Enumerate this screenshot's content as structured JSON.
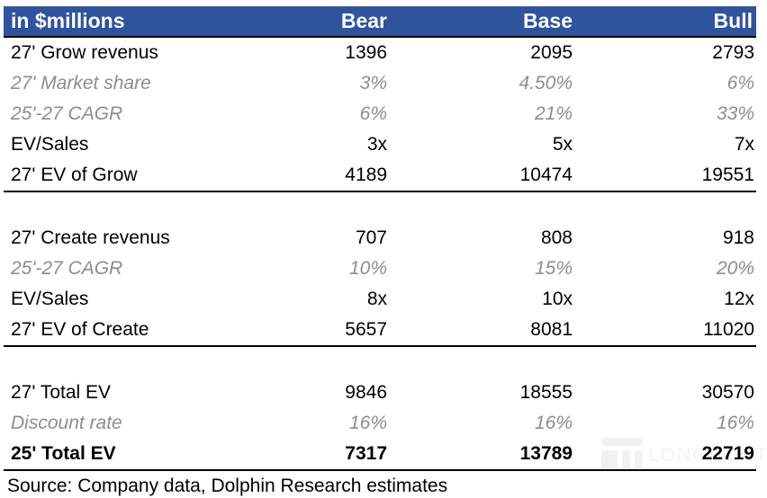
{
  "table": {
    "header": {
      "label": "in $millions",
      "columns": [
        "Bear",
        "Base",
        "Bull"
      ],
      "background_color": "#30539D",
      "text_color": "#FFFFFF"
    },
    "muted_color": "#8D8D8D",
    "blocks": [
      {
        "name": "grow",
        "rows": [
          {
            "label": "27' Grow revenus",
            "bear": "1396",
            "base": "2095",
            "bull": "2793",
            "style": "normal"
          },
          {
            "label": "27' Market share",
            "bear": "3%",
            "base": "4.50%",
            "bull": "6%",
            "style": "muted"
          },
          {
            "label": "25'-27 CAGR",
            "bear": "6%",
            "base": "21%",
            "bull": "33%",
            "style": "muted"
          },
          {
            "label": "EV/Sales",
            "bear": "3x",
            "base": "5x",
            "bull": "7x",
            "style": "normal"
          },
          {
            "label": "27' EV of Grow",
            "bear": "4189",
            "base": "10474",
            "bull": "19551",
            "style": "normal"
          }
        ]
      },
      {
        "name": "create",
        "rows": [
          {
            "label": "27' Create revenus",
            "bear": "707",
            "base": "808",
            "bull": "918",
            "style": "normal"
          },
          {
            "label": "25'-27 CAGR",
            "bear": "10%",
            "base": "15%",
            "bull": "20%",
            "style": "muted"
          },
          {
            "label": "EV/Sales",
            "bear": "8x",
            "base": "10x",
            "bull": "12x",
            "style": "normal"
          },
          {
            "label": "27' EV of Create",
            "bear": "5657",
            "base": "8081",
            "bull": "11020",
            "style": "normal"
          }
        ]
      },
      {
        "name": "total",
        "rows": [
          {
            "label": "27' Total EV",
            "bear": "9846",
            "base": "18555",
            "bull": "30570",
            "style": "normal"
          },
          {
            "label": "Discount rate",
            "bear": "16%",
            "base": "16%",
            "bull": "16%",
            "style": "muted"
          },
          {
            "label": "25' Total EV",
            "bear": "7317",
            "base": "13789",
            "bull": "22719",
            "style": "strong"
          }
        ]
      }
    ]
  },
  "footer": {
    "source": "Source: Company data, Dolphin Research estimates"
  },
  "watermark": {
    "text": "LONGPORT"
  }
}
